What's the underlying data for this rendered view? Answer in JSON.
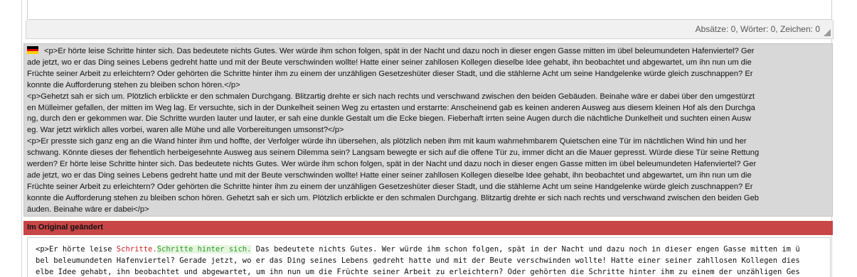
{
  "status_bar": {
    "counts": "Absätze: 0, Wörter: 0, Zeichen: 0"
  },
  "source": {
    "language_icon": "german-flag-icon",
    "lines": [
      "<p>Er hörte leise Schritte hinter sich. Das bedeutete nichts Gutes. Wer würde ihm schon folgen, spät in der Nacht und dazu noch in dieser engen Gasse mitten im übel beleumundeten Hafenviertel? Ger",
      "ade jetzt, wo er das Ding seines Lebens gedreht hatte und mit der Beute verschwinden wollte! Hatte einer seiner zahllosen Kollegen dieselbe Idee gehabt, ihn beobachtet und abgewartet, um ihn nun um die",
      "Früchte seiner Arbeit zu erleichtern? Oder gehörten die Schritte hinter ihm zu einem der unzähligen Gesetzeshüter dieser Stadt, und die stählerne Acht um seine Handgelenke würde gleich zuschnappen? Er",
      "konnte die Aufforderung stehen zu bleiben schon hören.</p>",
      "<p>Gehetzt sah er sich um. Plötzlich erblickte er den schmalen Durchgang. Blitzartig drehte er sich nach rechts und verschwand zwischen den beiden Gebäuden. Beinahe wäre er dabei über den umgestürzt",
      "en Mülleimer gefallen, der mitten im Weg lag. Er versuchte, sich in der Dunkelheit seinen Weg zu ertasten und erstarrte: Anscheinend gab es keinen anderen Ausweg aus diesem kleinen Hof als den Durchga",
      "ng, durch den er gekommen war. Die Schritte wurden lauter und lauter, er sah eine dunkle Gestalt um die Ecke biegen. Fieberhaft irrten seine Augen durch die nächtliche Dunkelheit und suchten einen Ausw",
      "eg. War jetzt wirklich alles vorbei, waren alle Mühe und alle Vorbereitungen umsonst?</p>",
      "<p>Er presste sich ganz eng an die Wand hinter ihm und hoffte, der Verfolger würde ihn übersehen, als plötzlich neben ihm mit kaum wahrnehmbarem Quietschen eine Tür im nächtlichen Wind hin und her",
      "schwang. Könnte dieses der flehentlich herbeigesehnte Ausweg aus seinem Dilemma sein? Langsam bewegte er sich auf die offene Tür zu, immer dicht an die Mauer gepresst. Würde diese Tür seine Rettung",
      "werden? Er hörte leise Schritte hinter sich. Das bedeutete nichts Gutes. Wer würde ihm schon folgen, spät in der Nacht und dazu noch in dieser engen Gasse mitten im übel beleumundeten Hafenviertel? Ger",
      "ade jetzt, wo er das Ding seines Lebens gedreht hatte und mit der Beute verschwinden wollte! Hatte einer seiner zahllosen Kollegen dieselbe Idee gehabt, ihn beobachtet und abgewartet, um ihn nun um die",
      "Früchte seiner Arbeit zu erleichtern? Oder gehörten die Schritte hinter ihm zu einem der unzähligen Gesetzeshüter dieser Stadt, und die stählerne Acht um seine Handgelenke würde gleich zuschnappen? Er",
      "konnte die Aufforderung stehen zu bleiben schon hören. Gehetzt sah er sich um. Plötzlich erblickte er den schmalen Durchgang. Blitzartig drehte er sich nach rechts und verschwand zwischen den beiden Geb",
      "äuden. Beinahe wäre er dabei</p>"
    ]
  },
  "changed_banner": {
    "label": "Im Original geändert",
    "color": "#c84646"
  },
  "diff": {
    "line1_prefix": "<p>Er hörte leise ",
    "line1_deleted": "Schritte.",
    "line1_inserted": "Schritte hinter sich.",
    "line1_suffix": " Das bedeutete nichts Gutes. Wer würde ihm schon folgen, spät in der Nacht und dazu noch in dieser engen Gasse mitten im ü",
    "line2": "bel beleumundeten Hafenviertel? Gerade jetzt, wo er das Ding seines Lebens gedreht hatte und mit der Beute verschwinden wollte! Hatte einer seiner zahllosen Kollegen dies",
    "line3": "elbe Idee gehabt, ihn beobachtet und abgewartet, um ihn nun um die Früchte seiner Arbeit zu erleichtern? Oder gehörten die Schritte hinter ihm zu einem der unzähligen Ges",
    "deleted_color": "#d02020",
    "inserted_color": "#2a9a2a"
  }
}
